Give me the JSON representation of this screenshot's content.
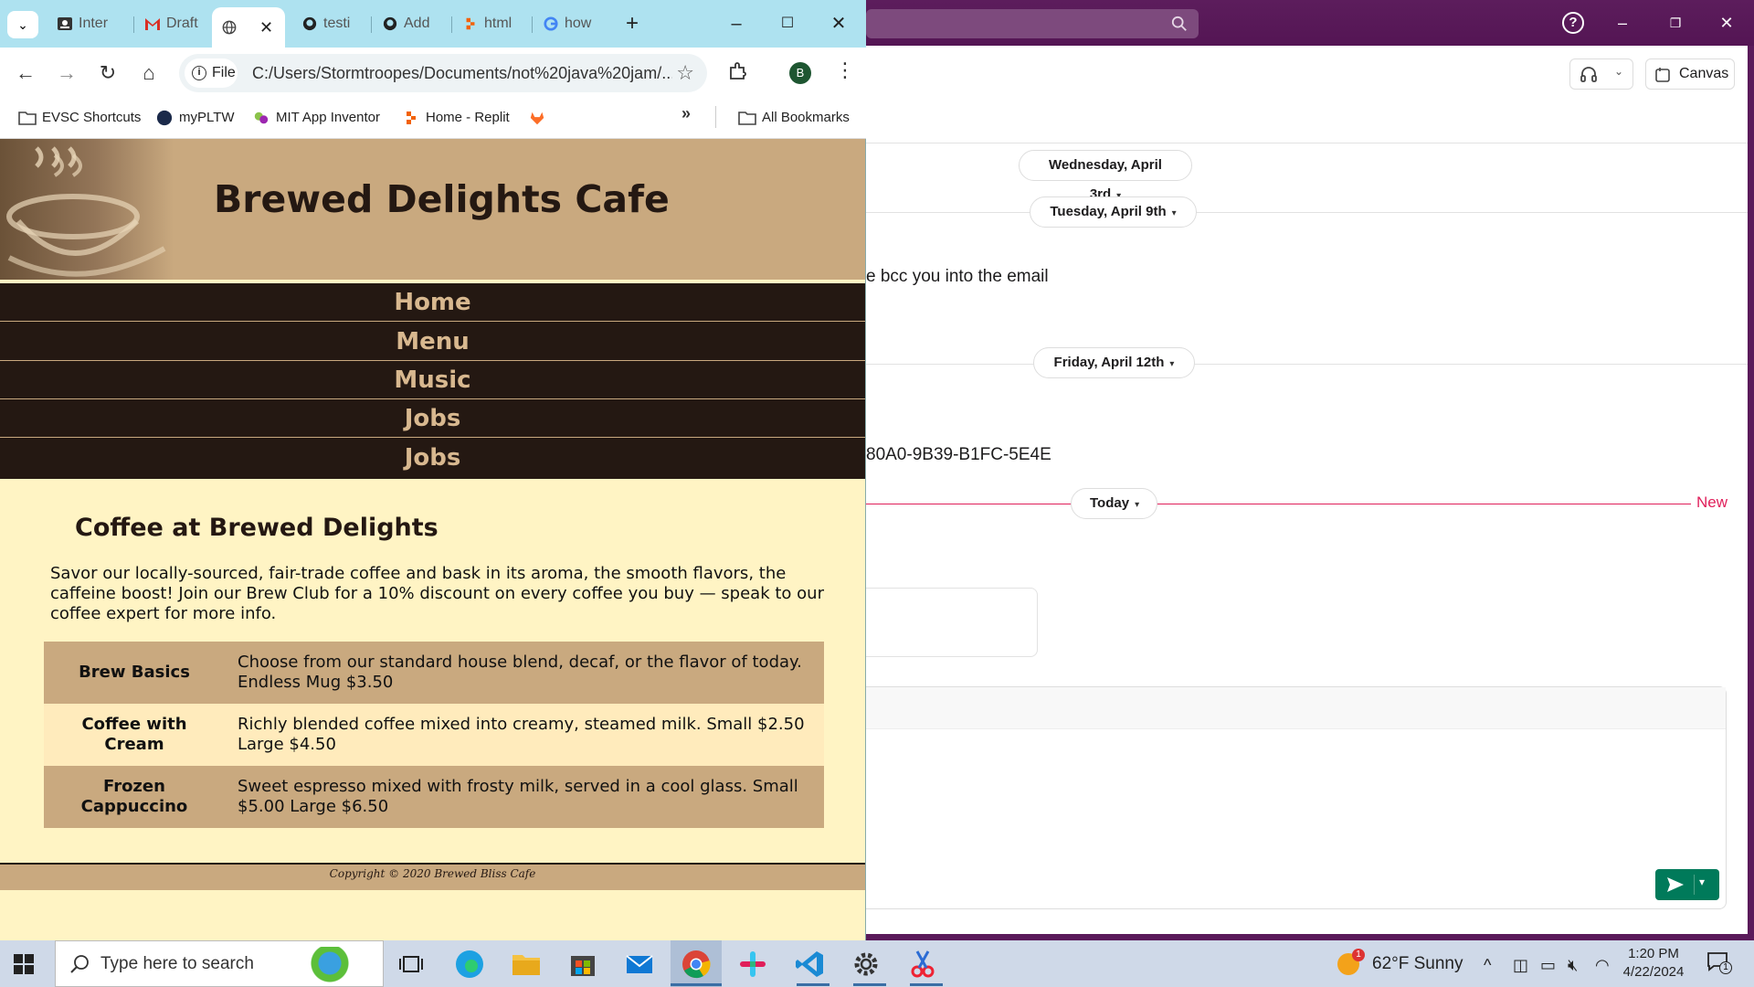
{
  "slack": {
    "canvas_label": "Canvas",
    "date_pills": [
      "Wednesday, April 3rd",
      "Tuesday, April 9th",
      "Friday, April 12th",
      "Today"
    ],
    "message_1": "e bcc you into the email",
    "message_2": "80A0-9B39-B1FC-5E4E",
    "new_label": "New",
    "help_label": "?"
  },
  "chrome": {
    "tabs": [
      {
        "label": "Inter",
        "icon": "classroom-icon"
      },
      {
        "label": "Draft",
        "icon": "gmail-icon"
      },
      {
        "label": "",
        "icon": "globe-icon",
        "active": true
      },
      {
        "label": "testi",
        "icon": "github-icon"
      },
      {
        "label": "Add",
        "icon": "github-icon"
      },
      {
        "label": "html",
        "icon": "replit-icon"
      },
      {
        "label": "how",
        "icon": "google-icon"
      }
    ],
    "omnibox": {
      "chip_label": "File",
      "url": "C:/Users/Stormtroopes/Documents/not%20java%20jam/..."
    },
    "profile_initial": "B",
    "bookmarks": [
      "EVSC Shortcuts",
      "myPLTW",
      "MIT App Inventor",
      "Home - Replit",
      "All Bookmarks"
    ],
    "bookmark_more": "»"
  },
  "site": {
    "title": "Brewed Delights Cafe",
    "nav": [
      "Home",
      "Menu",
      "Music",
      "Jobs",
      "Jobs"
    ],
    "heading": "Coffee at Brewed Delights",
    "intro": "Savor our locally-sourced, fair-trade coffee and bask in its aroma, the smooth flavors, the caffeine boost! Join our Brew Club for a 10% discount on every coffee you buy — speak to our coffee expert for more info.",
    "menu": [
      {
        "name": "Brew Basics",
        "desc": "Choose from our standard house blend, decaf, or the flavor of today. Endless Mug $3.50"
      },
      {
        "name": "Coffee with Cream",
        "desc": "Richly blended coffee mixed into creamy, steamed milk. Small $2.50 Large $4.50"
      },
      {
        "name": "Frozen Cappuccino",
        "desc": "Sweet espresso mixed with frosty milk, served in a cool glass. Small $5.00 Large $6.50"
      }
    ],
    "copyright": "Copyright © 2020 Brewed Bliss Cafe"
  },
  "taskbar": {
    "search_placeholder": "Type here to search",
    "weather": "62°F  Sunny",
    "weather_badge": "1",
    "time": "1:20 PM",
    "date": "4/22/2024",
    "notification_count": "1"
  },
  "colors": {
    "site_nav_bg": "#241812",
    "site_header_bg": "#c9a97f",
    "site_body_bg": "#fff4c4",
    "slack_purple": "#5a1a5a",
    "slack_new": "#e01e5a",
    "slack_send": "#007a5a"
  }
}
